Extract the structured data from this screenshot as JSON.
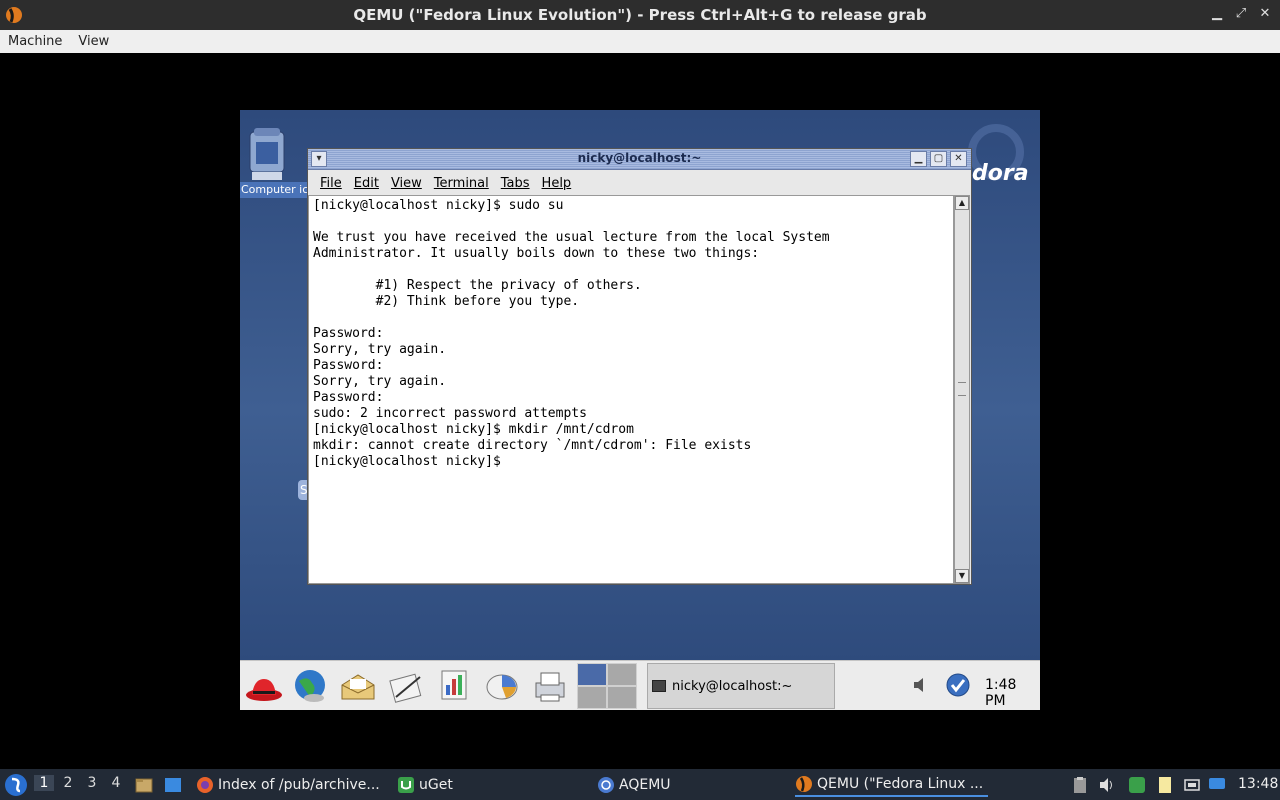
{
  "host_window": {
    "title": "QEMU (\"Fedora Linux Evolution\") - Press Ctrl+Alt+G to release grab",
    "controls": {
      "minimize": "▁",
      "restore": "⤢",
      "close": "✕"
    },
    "menu": [
      "Machine",
      "View"
    ]
  },
  "desktop": {
    "icon_label": "Computer ic",
    "partial_icon_letter": "S"
  },
  "terminal": {
    "title": "nicky@localhost:~",
    "menu": [
      "File",
      "Edit",
      "View",
      "Terminal",
      "Tabs",
      "Help"
    ],
    "lines": [
      "[nicky@localhost nicky]$ sudo su",
      "",
      "We trust you have received the usual lecture from the local System",
      "Administrator. It usually boils down to these two things:",
      "",
      "        #1) Respect the privacy of others.",
      "        #2) Think before you type.",
      "",
      "Password:",
      "Sorry, try again.",
      "Password:",
      "Sorry, try again.",
      "Password:",
      "sudo: 2 incorrect password attempts",
      "[nicky@localhost nicky]$ mkdir /mnt/cdrom",
      "mkdir: cannot create directory `/mnt/cdrom': File exists",
      "[nicky@localhost nicky]$ "
    ]
  },
  "guest_panel": {
    "task_label": "nicky@localhost:~",
    "clock": "1:48 PM"
  },
  "host_taskbar": {
    "workspaces": [
      "1",
      "2",
      "3",
      "4"
    ],
    "active_workspace": "1",
    "items": [
      {
        "label": "Index of /pub/archive...",
        "icon": "firefox-icon"
      },
      {
        "label": "uGet",
        "icon": "uget-icon"
      },
      {
        "label": "AQEMU",
        "icon": "aqemu-icon"
      },
      {
        "label": "QEMU (\"Fedora Linux ...",
        "icon": "qemu-icon"
      }
    ],
    "clock": "13:48"
  },
  "colors": {
    "guest_bg": "#3a5a8e",
    "host_taskbar": "#222a36",
    "active_indicator": "#4a8fe0"
  }
}
